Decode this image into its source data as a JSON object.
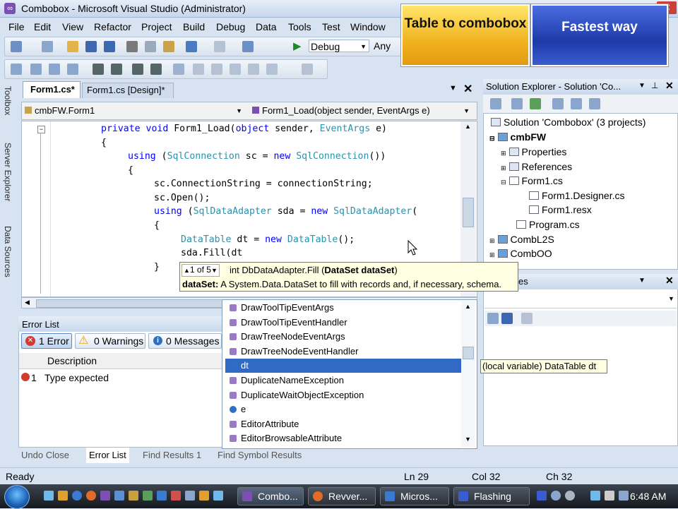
{
  "window": {
    "title": "Combobox - Microsoft Visual Studio (Administrator)"
  },
  "menu": [
    "File",
    "Edit",
    "View",
    "Refactor",
    "Project",
    "Build",
    "Debug",
    "Data",
    "Tools",
    "Test",
    "Window"
  ],
  "toolbar": {
    "config": "Debug",
    "platform": "Any CP"
  },
  "banners": {
    "left": "Table to combobox",
    "right": "Fastest way"
  },
  "doc_tabs": [
    {
      "label": "Form1.cs*",
      "active": true
    },
    {
      "label": "Form1.cs [Design]*",
      "active": false
    }
  ],
  "navbar": {
    "type": "cmbFW.Form1",
    "member": "Form1_Load(object sender, EventArgs e)"
  },
  "code": {
    "l1": "private void Form1_Load(object sender, EventArgs e)",
    "l2": "{",
    "l3": "using (SqlConnection sc = new SqlConnection())",
    "l4": "{",
    "l5": "sc.ConnectionString = connectionString;",
    "l6": "sc.Open();",
    "l7": "using (SqlDataAdapter sda = new SqlDataAdapter(",
    "l8": "{",
    "l9": "DataTable dt = new DataTable();",
    "l10": "sda.Fill(dt",
    "l11": "}"
  },
  "param_info": {
    "counter": "1 of 5",
    "signature": "int DbDataAdapter.Fill (",
    "param": "DataSet dataSet",
    ")": ")",
    "desc_label": "dataSet:",
    "desc": " A System.Data.DataSet to fill with records and, if necessary, schema."
  },
  "completion": {
    "items": [
      "DrawToolTipEventArgs",
      "DrawToolTipEventHandler",
      "DrawTreeNodeEventArgs",
      "DrawTreeNodeEventHandler",
      "dt",
      "DuplicateNameException",
      "DuplicateWaitObjectException",
      "e",
      "EditorAttribute",
      "EditorBrowsableAttribute"
    ],
    "selected_index": 4,
    "tooltip": "(local variable) DataTable dt"
  },
  "sidebar": [
    "Toolbox",
    "Server Explorer",
    "Data Sources"
  ],
  "error_list": {
    "title": "Error List",
    "errors": "1 Error",
    "warnings": "0 Warnings",
    "messages": "0 Messages",
    "col_description": "Description",
    "rows": [
      {
        "num": "1",
        "desc": "Type expected"
      }
    ]
  },
  "bottom_tabs": [
    "Undo Close",
    "Error List",
    "Find Results 1",
    "Find Symbol Results"
  ],
  "solution_explorer": {
    "title": "Solution Explorer - Solution 'Co...",
    "nodes": [
      {
        "label": "Solution 'Combobox' (3 projects)"
      },
      {
        "label": "cmbFW"
      },
      {
        "label": "Properties"
      },
      {
        "label": "References"
      },
      {
        "label": "Form1.cs"
      },
      {
        "label": "Form1.Designer.cs"
      },
      {
        "label": "Form1.resx"
      },
      {
        "label": "Program.cs"
      },
      {
        "label": "CombL2S"
      },
      {
        "label": "CombOO"
      }
    ]
  },
  "properties": {
    "title_fragment": "es"
  },
  "status": {
    "ready": "Ready",
    "ln": "Ln 29",
    "col": "Col 32",
    "ch": "Ch 32"
  },
  "taskbar": {
    "items": [
      "Combo...",
      "Revver...",
      "Micros...",
      "Flashing"
    ],
    "time": "6:48 AM"
  },
  "colors": {
    "keyword": "#0000ff",
    "type": "#2b91af",
    "selection": "#316ac5"
  }
}
